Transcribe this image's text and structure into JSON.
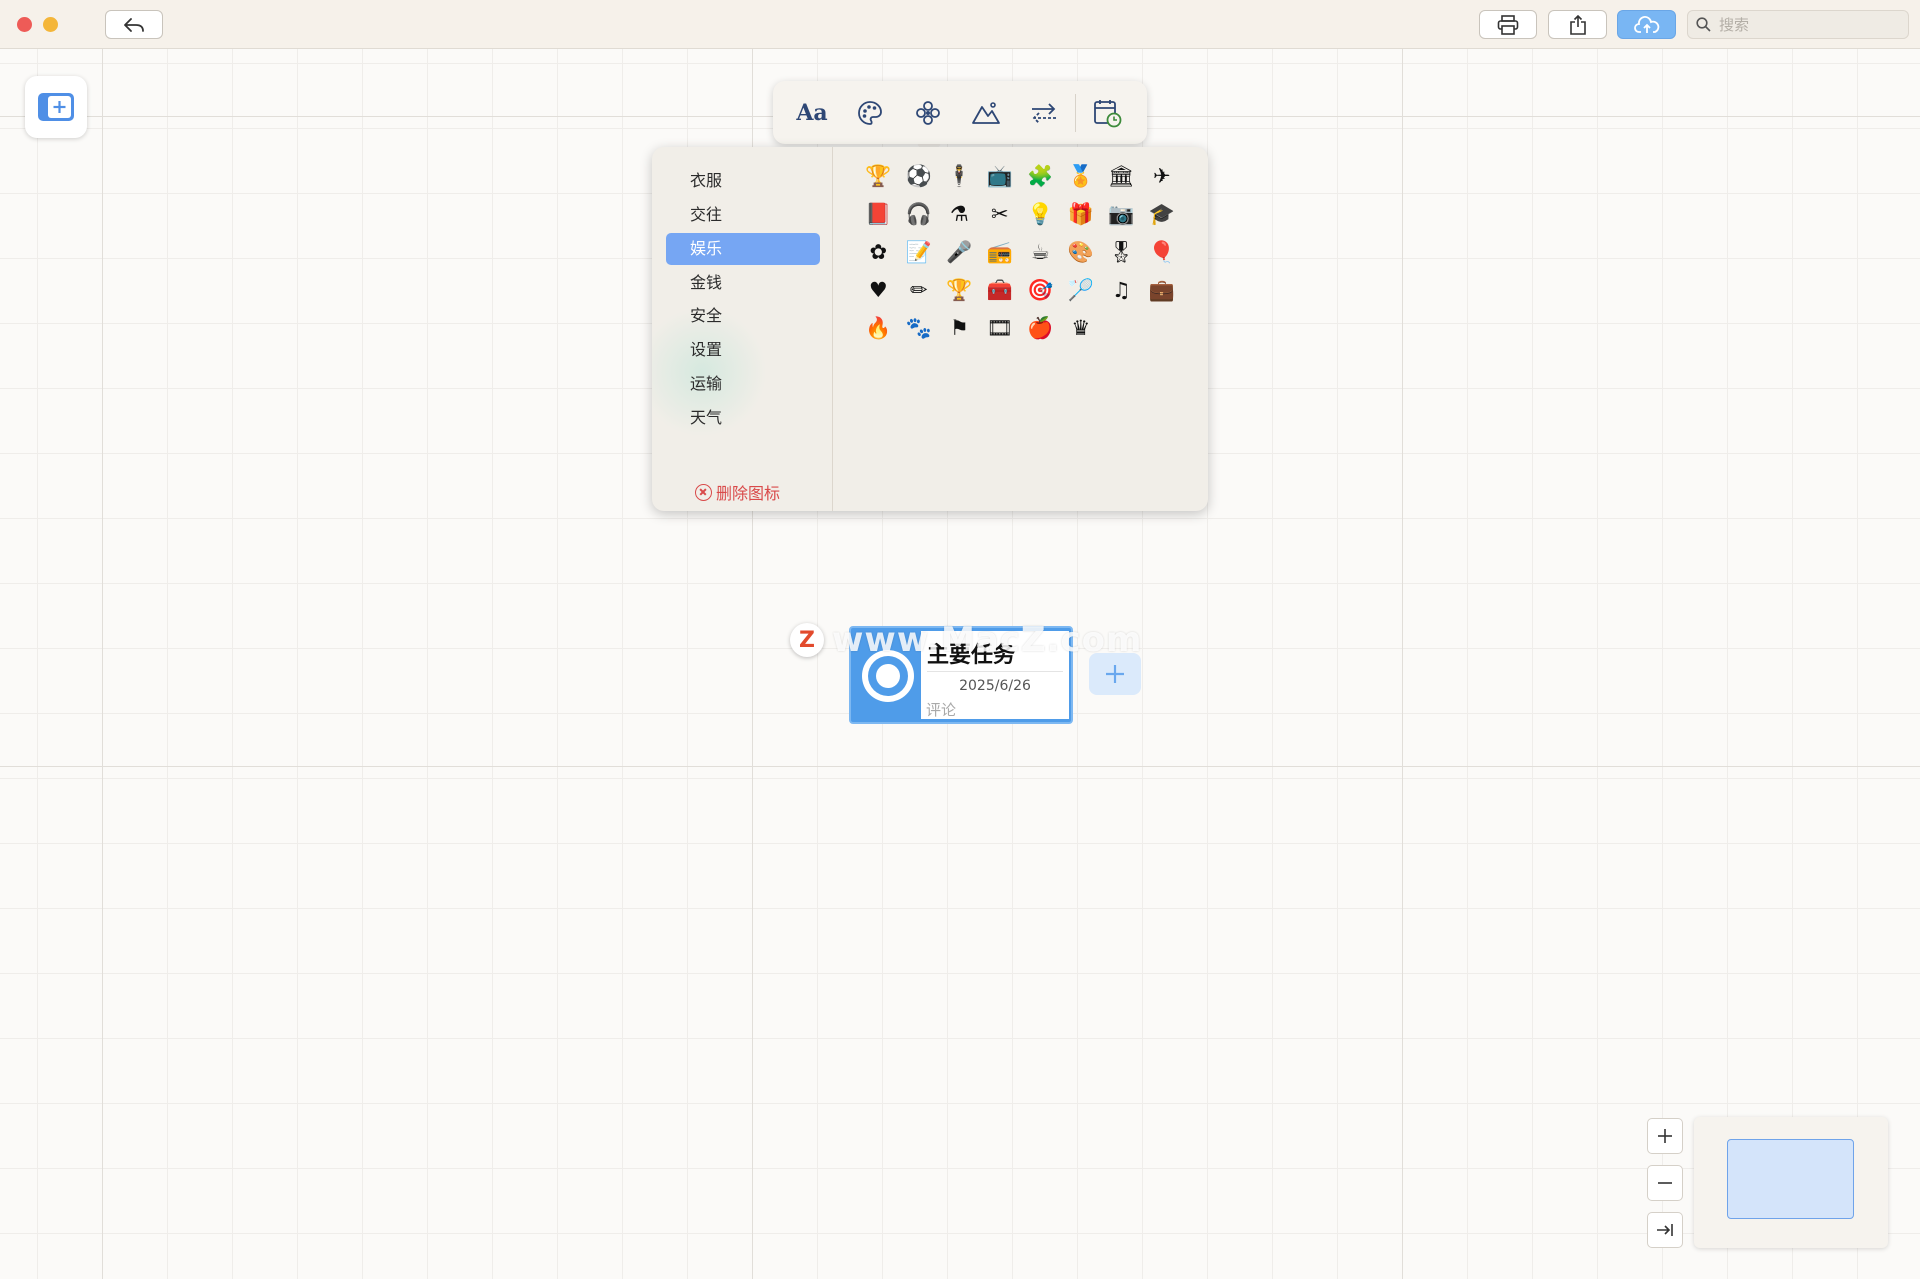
{
  "titlebar": {
    "search_placeholder": "搜索"
  },
  "format_toolbar": {
    "text_button_label": "Aa"
  },
  "icon_picker": {
    "categories": [
      "衣服",
      "交往",
      "娱乐",
      "金钱",
      "安全",
      "设置",
      "运输",
      "天气"
    ],
    "selected_category": "娱乐",
    "delete_label": "删除图标",
    "icons": [
      "🏆",
      "⚽",
      "🕴",
      "📺",
      "🧩",
      "🏅",
      "🏛",
      "✈",
      "📕",
      "🎧",
      "⚗",
      "✂",
      "💡",
      "🎁",
      "📷",
      "🎓",
      "✿",
      "📝",
      "🎤",
      "📻",
      "☕",
      "🎨",
      "🎖",
      "🎈",
      "♥",
      "✏",
      "🏆",
      "🧰",
      "🎯",
      "🏸",
      "♫",
      "💼",
      "🔥",
      "🐾",
      "⚑",
      "🎞",
      "🍎",
      "♛"
    ]
  },
  "node": {
    "title": "主要任务",
    "date": "2025/6/26",
    "comment_placeholder": "评论"
  },
  "watermark": {
    "badge": "Z",
    "text": "www.MacZ.com"
  },
  "colors": {
    "accent": "#76a6f3",
    "node_blue": "#4f9ce9",
    "danger": "#d94a4a",
    "toolbar_icon": "#2e4775"
  }
}
